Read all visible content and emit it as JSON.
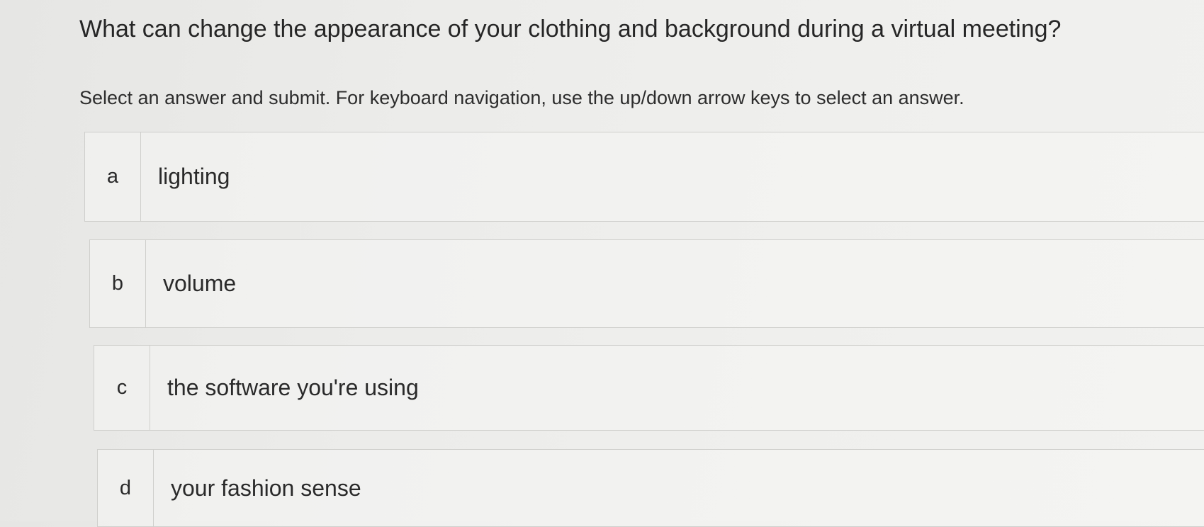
{
  "question": {
    "text": "What can change the appearance of your clothing and background during a virtual meeting?"
  },
  "instruction": {
    "text": "Select an answer and submit. For keyboard navigation, use the up/down arrow keys to select an answer."
  },
  "options": [
    {
      "letter": "a",
      "label": "lighting"
    },
    {
      "letter": "b",
      "label": "volume"
    },
    {
      "letter": "c",
      "label": "the software you're using"
    },
    {
      "letter": "d",
      "label": "your fashion sense"
    }
  ]
}
